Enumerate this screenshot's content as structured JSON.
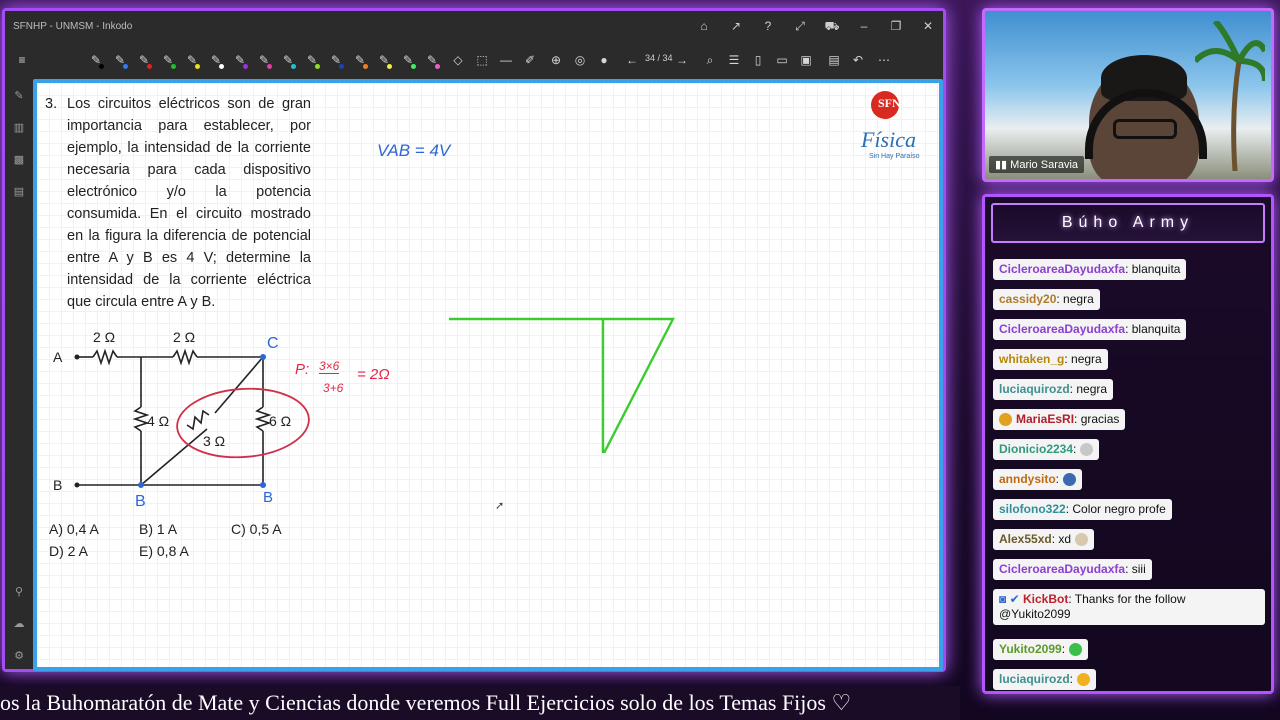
{
  "window": {
    "title": "SFNHP - UNMSM - Inkodo",
    "page_indicator": "34 / 34"
  },
  "problem": {
    "number": "3.",
    "text": "Los circuitos eléctricos son de gran importancia para establecer, por ejemplo, la intensidad de la corriente necesaria para cada dispositivo electrónico y/o la potencia consumida. En el circuito mostrado en la figura la diferencia de potencial entre A y B es 4 V; determine la intensidad de la corriente eléctrica que circula entre A y B.",
    "options": [
      "A) 0,4 A",
      "B) 1 A",
      "C) 0,5 A",
      "D) 2 A",
      "E) 0,8 A"
    ]
  },
  "circuit": {
    "node_a": "A",
    "node_b": "B",
    "node_c": "C",
    "r_top_left": "2 Ω",
    "r_top_right": "2 Ω",
    "r_middle": "4 Ω",
    "r_right": "6 Ω",
    "r_diag": "3 Ω"
  },
  "annotations": {
    "vab": "VAB = 4V",
    "b_label_left": "B",
    "b_label_right": "B",
    "parallel_prefix": "P:",
    "parallel_num": "3×6",
    "parallel_den": "3+6",
    "parallel_result": "= 2Ω"
  },
  "logo": {
    "brand": "Física",
    "tagline": "Sin Hay Paraíso",
    "badge": "SFN"
  },
  "webcam": {
    "name": "Mario Saravia"
  },
  "chat": {
    "title": "Búho Army",
    "messages": [
      {
        "user": "CicleroareaDayudaxfa",
        "color": "#8b3fd1",
        "text": ": blanquita"
      },
      {
        "user": "cassidy20",
        "color": "#b07a2a",
        "text": ": negra"
      },
      {
        "user": "CicleroareaDayudaxfa",
        "color": "#8b3fd1",
        "text": ": blanquita"
      },
      {
        "user": "whitaken_g",
        "color": "#b8860b",
        "text": ": negra"
      },
      {
        "user": "luciaquirozd",
        "color": "#3f8f8f",
        "text": ": negra"
      },
      {
        "user": "MariaEsRI",
        "color": "#b0202a",
        "text": ": gracias"
      },
      {
        "user": "Dionicio2234",
        "color": "#2f9a7a",
        "text": ":"
      },
      {
        "user": "anndysito",
        "color": "#c06a10",
        "text": ":"
      },
      {
        "user": "silofono322",
        "color": "#2f8f9a",
        "text": ": Color negro profe"
      },
      {
        "user": "Alex55xd",
        "color": "#6a5a2a",
        "text": ": xd"
      },
      {
        "user": "CicleroareaDayudaxfa",
        "color": "#8b3fd1",
        "text": ": siii"
      },
      {
        "user": "KickBot",
        "color": "#c0202a",
        "text": ": Thanks for the follow",
        "text2": "@Yukito2099"
      },
      {
        "user": "Yukito2099",
        "color": "#5a9a2a",
        "text": ":"
      },
      {
        "user": "luciaquirozd",
        "color": "#3f8f8f",
        "text": ":"
      }
    ]
  },
  "ticker": {
    "text": "os la Buhomaratón de Mate y Ciencias donde veremos Full Ejercicios solo de los Temas Fijos ♡"
  }
}
